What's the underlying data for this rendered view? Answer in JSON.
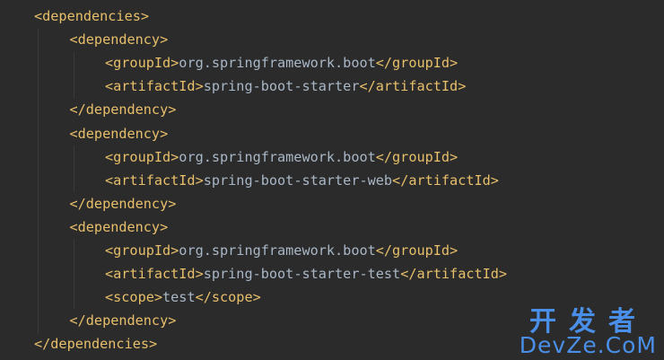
{
  "code": {
    "lines": [
      {
        "indent": 0,
        "open": "<dependencies>",
        "text": "",
        "close": ""
      },
      {
        "indent": 1,
        "open": "<dependency>",
        "text": "",
        "close": ""
      },
      {
        "indent": 2,
        "open": "<groupId>",
        "text": "org.springframework.boot",
        "close": "</groupId>"
      },
      {
        "indent": 2,
        "open": "<artifactId>",
        "text": "spring-boot-starter",
        "close": "</artifactId>"
      },
      {
        "indent": 1,
        "open": "</dependency>",
        "text": "",
        "close": ""
      },
      {
        "indent": 1,
        "open": "<dependency>",
        "text": "",
        "close": ""
      },
      {
        "indent": 2,
        "open": "<groupId>",
        "text": "org.springframework.boot",
        "close": "</groupId>"
      },
      {
        "indent": 2,
        "open": "<artifactId>",
        "text": "spring-boot-starter-web",
        "close": "</artifactId>"
      },
      {
        "indent": 1,
        "open": "</dependency>",
        "text": "",
        "close": ""
      },
      {
        "indent": 1,
        "open": "<dependency>",
        "text": "",
        "close": ""
      },
      {
        "indent": 2,
        "open": "<groupId>",
        "text": "org.springframework.boot",
        "close": "</groupId>"
      },
      {
        "indent": 2,
        "open": "<artifactId>",
        "text": "spring-boot-starter-test",
        "close": "</artifactId>"
      },
      {
        "indent": 2,
        "open": "<scope>",
        "text": "test",
        "close": "</scope>"
      },
      {
        "indent": 1,
        "open": "</dependency>",
        "text": "",
        "close": ""
      },
      {
        "indent": 0,
        "open": "</dependencies>",
        "text": "",
        "close": ""
      }
    ]
  },
  "watermark": {
    "cn": "开发者",
    "en": "DevZe.CoM"
  },
  "colors": {
    "background": "#2b2b2b",
    "tag": "#e8bf6a",
    "text": "#a9b7c6",
    "watermark": "#4a8fe7"
  }
}
